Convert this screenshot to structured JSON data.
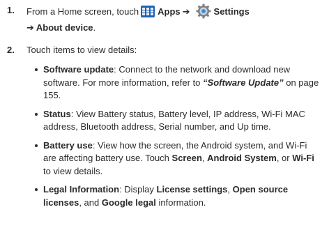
{
  "step1": {
    "number": "1.",
    "prefix": "From a Home screen, touch",
    "apps": "Apps",
    "arrow1": "➔",
    "settings": "Settings",
    "arrow2": "➔",
    "about": "About device",
    "period": ".",
    "apps_icon": "apps-grid-icon",
    "settings_icon": "gear-icon"
  },
  "step2": {
    "number": "2.",
    "text": "Touch items to view details:"
  },
  "bullets": [
    {
      "term": "Software update",
      "text1": ": Connect to the network and download new software. For more information, refer to ",
      "ref": "“Software Update”",
      "text2": " on page 155."
    },
    {
      "term": "Status",
      "text1": ": View Battery status, Battery level, IP address, Wi-Fi MAC address, Bluetooth address, Serial number, and Up time."
    },
    {
      "term": "Battery use",
      "text1": ": View how the screen, the Android system, and Wi-Fi are affecting battery use. Touch ",
      "screen": "Screen",
      "sep1": ", ",
      "android": "Android System",
      "sep2": ", or ",
      "wifi": "Wi-Fi",
      "text2": " to view details."
    },
    {
      "term": "Legal Information",
      "text1": ": Display ",
      "license": "License settings",
      "sep1": ", ",
      "opensource": "Open source licenses",
      "sep2": ", and ",
      "google": "Google legal",
      "text2": " information."
    }
  ]
}
